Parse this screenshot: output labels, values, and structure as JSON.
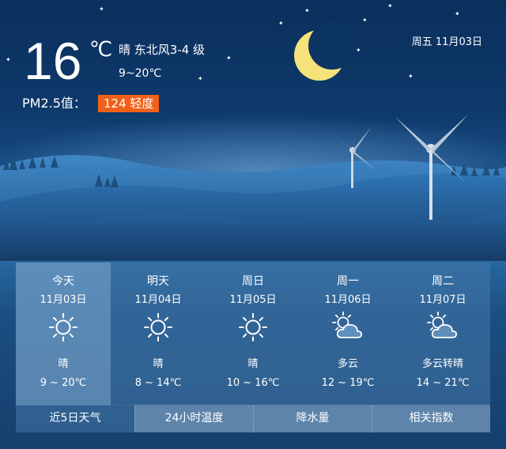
{
  "current": {
    "temperature": "16",
    "unit": "℃",
    "condition_wind": "晴 东北风3-4 级",
    "range": "9~20℃",
    "pm_label": "PM2.5值：",
    "pm_value": "124 轻度"
  },
  "date": "周五  11月03日",
  "forecast": [
    {
      "name": "今天",
      "date": "11月03日",
      "icon": "sun-icon",
      "condition": "晴",
      "range": "9 ~ 20℃"
    },
    {
      "name": "明天",
      "date": "11月04日",
      "icon": "sun-icon",
      "condition": "晴",
      "range": "8 ~ 14℃"
    },
    {
      "name": "周日",
      "date": "11月05日",
      "icon": "sun-icon",
      "condition": "晴",
      "range": "10 ~ 16℃"
    },
    {
      "name": "周一",
      "date": "11月06日",
      "icon": "partly-cloudy-icon",
      "condition": "多云",
      "range": "12 ~ 19℃"
    },
    {
      "name": "周二",
      "date": "11月07日",
      "icon": "partly-cloudy-icon",
      "condition": "多云转晴",
      "range": "14 ~ 21℃"
    }
  ],
  "tabs": [
    "近5日天气",
    "24小时温度",
    "降水量",
    "相关指数"
  ],
  "colors": {
    "pm_badge": "#f0601a",
    "moon": "#f6e27a",
    "sky": "#0a2f5c"
  }
}
